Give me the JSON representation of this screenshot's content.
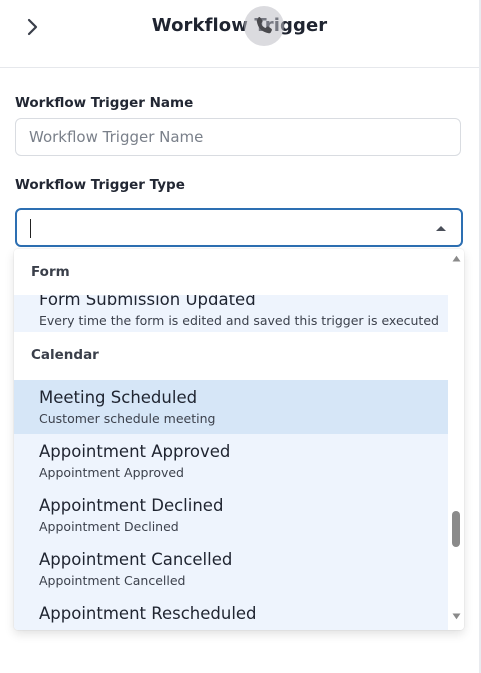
{
  "header": {
    "title": "Workflow Trigger",
    "back_icon": "chevron-right-icon",
    "overlay_icon": "phone-icon"
  },
  "form": {
    "name_label": "Workflow Trigger Name",
    "name_placeholder": "Workflow Trigger Name",
    "name_value": "",
    "type_label": "Workflow Trigger Type",
    "type_value": ""
  },
  "dropdown": {
    "groups": [
      {
        "label": "Form",
        "options": [
          {
            "title": "Form Submission Updated",
            "description": "Every time the form is edited and saved this trigger is executed"
          }
        ]
      },
      {
        "label": "Calendar",
        "options": [
          {
            "title": "Meeting Scheduled",
            "description": "Customer schedule meeting",
            "selected": true
          },
          {
            "title": "Appointment Approved",
            "description": "Appointment Approved"
          },
          {
            "title": "Appointment Declined",
            "description": "Appointment Declined"
          },
          {
            "title": "Appointment Cancelled",
            "description": "Appointment Cancelled"
          },
          {
            "title": "Appointment Rescheduled",
            "description": ""
          }
        ]
      }
    ]
  },
  "colors": {
    "focus_border": "#2d6fb2",
    "option_bg": "#eef4fd",
    "option_selected_bg": "#d6e6f7"
  }
}
